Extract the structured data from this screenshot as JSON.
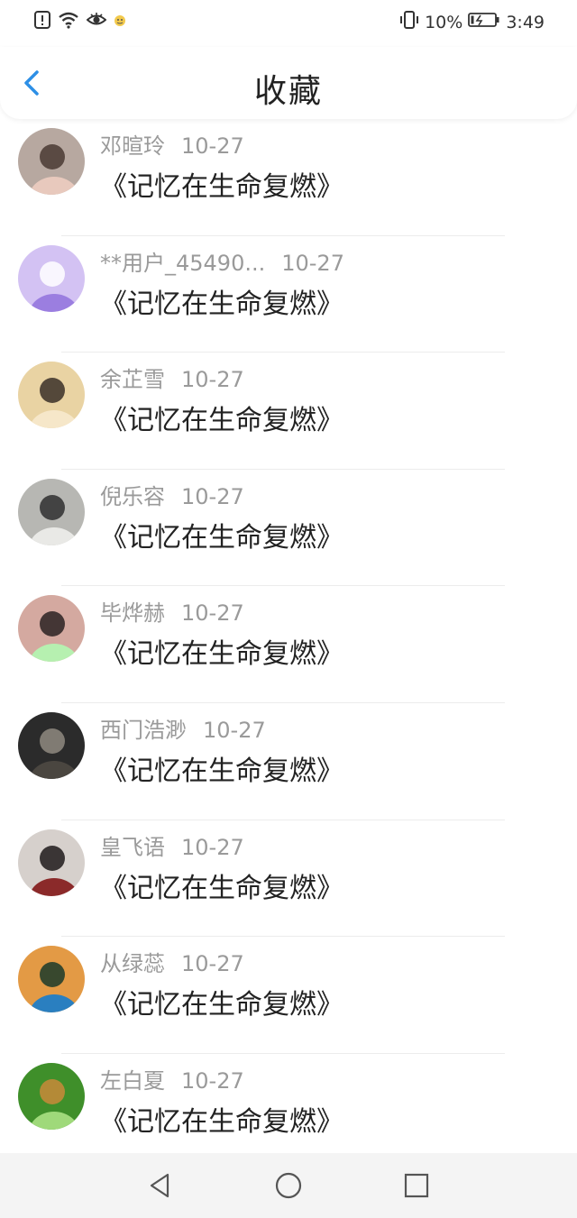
{
  "status_bar": {
    "battery_percent": "10%",
    "time": "3:49",
    "icons": [
      "alert-icon",
      "wifi-icon",
      "eye-icon",
      "emoji-icon",
      "vibrate-icon",
      "battery-icon"
    ]
  },
  "header": {
    "title": "收藏",
    "back_icon": "chevron-left-icon"
  },
  "favorites": [
    {
      "name": "邓暄玲",
      "date": "10-27",
      "title": "《记忆在生命复燃》",
      "avatar": {
        "bg": "#b7a8a0",
        "fg": "#4a3a32",
        "accent": "#e8c9bd"
      }
    },
    {
      "name": "**用户_45490...",
      "date": "10-27",
      "title": "《记忆在生命复燃》",
      "avatar": {
        "bg": "#d3c2f3",
        "fg": "#ffffff",
        "accent": "#9b7ee0"
      }
    },
    {
      "name": "余芷雪",
      "date": "10-27",
      "title": "《记忆在生命复燃》",
      "avatar": {
        "bg": "#e9d3a3",
        "fg": "#3a2f28",
        "accent": "#f6e7c9"
      }
    },
    {
      "name": "倪乐容",
      "date": "10-27",
      "title": "《记忆在生命复燃》",
      "avatar": {
        "bg": "#b7b7b3",
        "fg": "#2f2f2f",
        "accent": "#e9e9e6"
      }
    },
    {
      "name": "毕烨赫",
      "date": "10-27",
      "title": "《记忆在生命复燃》",
      "avatar": {
        "bg": "#d4a9a0",
        "fg": "#2a2222",
        "accent": "#b6f0b0"
      }
    },
    {
      "name": "西门浩渺",
      "date": "10-27",
      "title": "《记忆在生命复燃》",
      "avatar": {
        "bg": "#2b2b2b",
        "fg": "#8f8a80",
        "accent": "#4a4640"
      }
    },
    {
      "name": "皇飞语",
      "date": "10-27",
      "title": "《记忆在生命复燃》",
      "avatar": {
        "bg": "#d6d0cc",
        "fg": "#1e1a1a",
        "accent": "#8b2a2a"
      }
    },
    {
      "name": "从绿蕊",
      "date": "10-27",
      "title": "《记忆在生命复燃》",
      "avatar": {
        "bg": "#e39a45",
        "fg": "#1a3a2a",
        "accent": "#2a7fc0"
      }
    },
    {
      "name": "左白夏",
      "date": "10-27",
      "title": "《记忆在生命复燃》",
      "avatar": {
        "bg": "#3f8f2a",
        "fg": "#c98a3a",
        "accent": "#9fd97a"
      }
    }
  ],
  "nav_bar": {
    "buttons": [
      "back-triangle-icon",
      "home-circle-icon",
      "recents-square-icon"
    ]
  },
  "colors": {
    "accent_blue": "#2d8fe6",
    "meta_gray": "#9a9a9a",
    "title_text": "#222222"
  }
}
